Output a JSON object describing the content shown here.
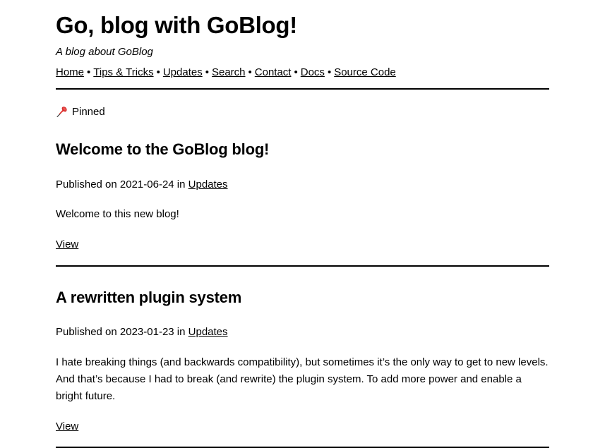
{
  "header": {
    "title": "Go, blog with GoBlog!",
    "subtitle": "A blog about GoBlog",
    "nav": {
      "separator": "•",
      "items": [
        {
          "label": "Home"
        },
        {
          "label": "Tips & Tricks"
        },
        {
          "label": "Updates"
        },
        {
          "label": "Search"
        },
        {
          "label": "Contact"
        },
        {
          "label": "Docs"
        },
        {
          "label": "Source Code"
        }
      ]
    }
  },
  "pinned": {
    "icon": "pushpin-icon",
    "label": "Pinned",
    "icon_color": "#d32f2f"
  },
  "posts": [
    {
      "title": "Welcome to the GoBlog blog!",
      "meta_prefix": "Published on ",
      "date": "2021-06-24",
      "meta_infix": " in ",
      "category": "Updates",
      "body": "Welcome to this new blog!",
      "view_label": "View"
    },
    {
      "title": "A rewritten plugin system",
      "meta_prefix": "Published on ",
      "date": "2023-01-23",
      "meta_infix": " in ",
      "category": "Updates",
      "body": "I hate breaking things (and backwards compatibility), but sometimes it’s the only way to get to new levels. And that’s because I had to break (and rewrite) the plugin system. To add more power and enable a bright future.",
      "view_label": "View"
    }
  ]
}
